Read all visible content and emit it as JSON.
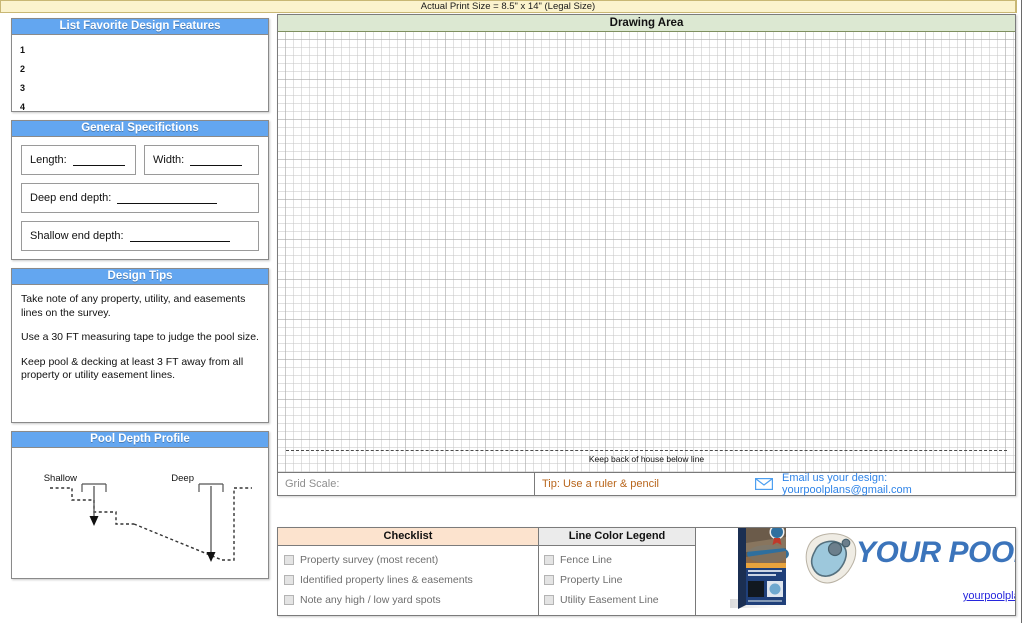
{
  "banner": {
    "text": "Actual Print Size = 8.5\" x 14\" (Legal Size)"
  },
  "colors": {
    "panel_header_blue": "#63A6F0",
    "banner_cream": "#FBF3CD",
    "drawing_header_green": "#DCE8D2",
    "checklist_header_peach": "#FCE3CE",
    "legend_header_grey": "#EBEBEB",
    "tip_brown": "#B8651B",
    "email_blue": "#2F84E8",
    "brand_blue": "#3B74BB",
    "link_blue": "#2727DD"
  },
  "features_panel": {
    "title": "List Favorite Design Features",
    "rows": [
      "1",
      "2",
      "3",
      "4"
    ]
  },
  "specs_panel": {
    "title": "General Specifictions",
    "fields": [
      {
        "label": "Length:"
      },
      {
        "label": "Width:"
      },
      {
        "label": "Deep end depth:"
      },
      {
        "label": "Shallow end depth:"
      }
    ]
  },
  "tips_panel": {
    "title": "Design Tips",
    "tips": [
      "Take note of any property, utility, and easements lines on the survey.",
      "Use a 30 FT measuring tape to judge the pool size.",
      "Keep pool & decking at least 3 FT away from all property or utility easement lines."
    ]
  },
  "profile_panel": {
    "title": "Pool Depth Profile",
    "shallow_label": "Shallow",
    "deep_label": "Deep"
  },
  "drawing_area": {
    "title": "Drawing Area",
    "house_note": "Keep back of house below line"
  },
  "info_row": {
    "grid_scale_label": "Grid Scale:",
    "tip_text": "Tip: Use a ruler & pencil",
    "email_text": "Email us your design: yourpoolplans@gmail.com",
    "email_icon": "envelope-icon"
  },
  "checklist": {
    "title": "Checklist",
    "items": [
      "Property survey (most recent)",
      "Identified property lines & easements",
      "Note any high / low yard spots"
    ]
  },
  "legend": {
    "title": "Line Color Legend",
    "items": [
      "Fence Line",
      "Property Line",
      "Utility Easement Line"
    ]
  },
  "brand": {
    "name": "YOUR POOL PLANS",
    "url": "yourpoolplans.com",
    "book_icon": "pool-plans-book-icon",
    "logo_icon": "pool-shape-logo-icon"
  }
}
